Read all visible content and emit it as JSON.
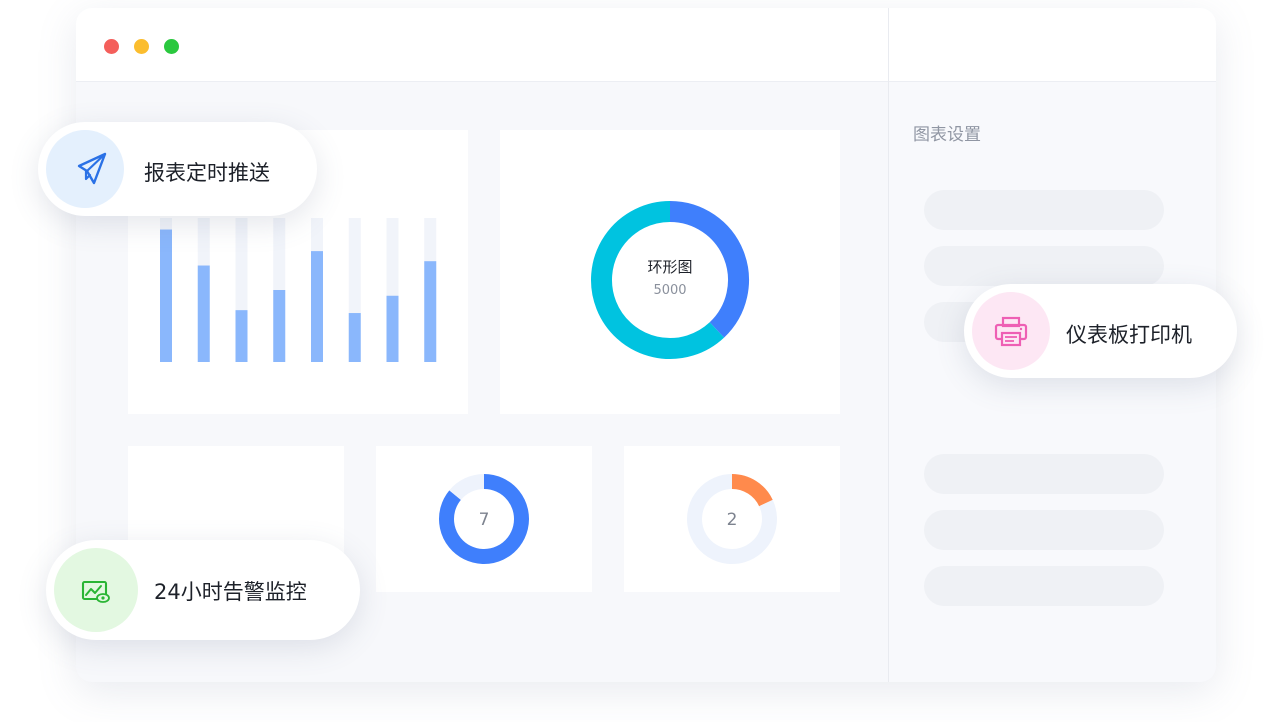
{
  "colors": {
    "accent_blue": "#3f7ffc",
    "cyan": "#00c3e0",
    "bar_blue": "#8ab7fc",
    "orange": "#ff8a4c",
    "pink": "#ee5fb4",
    "green": "#2ab535"
  },
  "sidebar": {
    "title": "图表设置"
  },
  "chart_data": [
    {
      "type": "bar",
      "categories": [
        "",
        "",
        "",
        "",
        "",
        "",
        "",
        ""
      ],
      "values": [
        92,
        67,
        36,
        50,
        77,
        34,
        46,
        70
      ],
      "ylim": [
        0,
        100
      ]
    },
    {
      "type": "pie",
      "title": "环形图",
      "center_value": "5000",
      "slices": [
        {
          "label": "",
          "value": 0.38,
          "color": "#3f7ffc"
        },
        {
          "label": "",
          "value": 0.62,
          "color": "#00c3e0"
        }
      ]
    },
    {
      "type": "pie",
      "center_value": "7",
      "slices": [
        {
          "label": "",
          "value": 0.86,
          "color": "#3f7ffc"
        },
        {
          "label": "",
          "value": 0.14,
          "color": "#eef3fc"
        }
      ]
    },
    {
      "type": "pie",
      "center_value": "2",
      "slices": [
        {
          "label": "",
          "value": 0.18,
          "color": "#ff8a4c"
        },
        {
          "label": "",
          "value": 0.82,
          "color": "#eef3fc"
        }
      ]
    }
  ],
  "features": {
    "scheduled_push": {
      "label": "报表定时推送",
      "icon": "paper-plane-icon"
    },
    "dashboard_printer": {
      "label": "仪表板打印机",
      "icon": "printer-icon"
    },
    "alert_monitoring": {
      "label": "24小时告警监控",
      "icon": "monitor-eye-icon"
    }
  }
}
